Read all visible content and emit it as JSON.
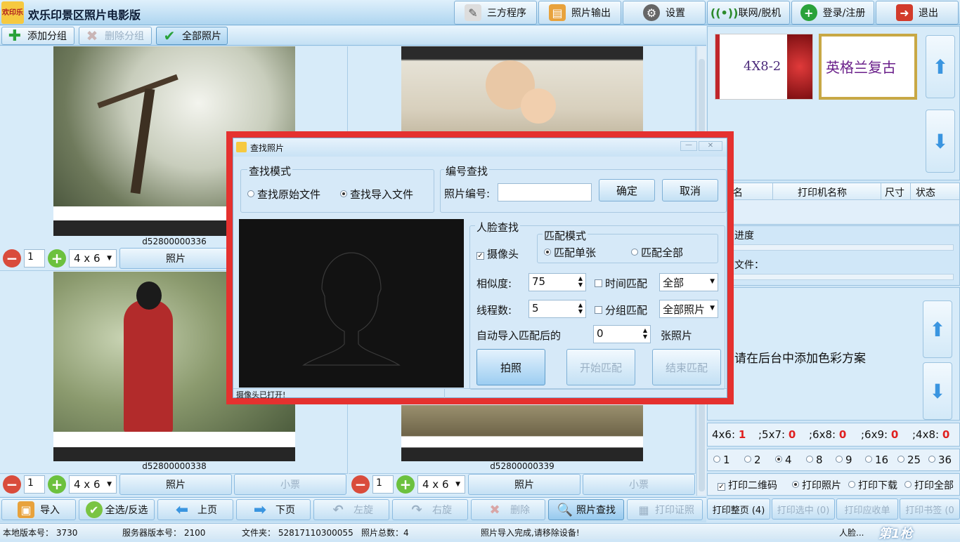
{
  "app": {
    "title": "欢乐印景区照片电影版",
    "logo_text": "欢印乐"
  },
  "toolbar": {
    "items": [
      {
        "label": "三方程序",
        "icon": "tools-icon"
      },
      {
        "label": "照片输出",
        "icon": "film-icon"
      },
      {
        "label": "设置",
        "icon": "gear-icon"
      },
      {
        "label": "联网/脱机",
        "icon": "antenna-icon"
      },
      {
        "label": "登录/注册",
        "icon": "add-user-icon"
      },
      {
        "label": "退出",
        "icon": "exit-icon"
      }
    ]
  },
  "group_bar": {
    "add": "添加分组",
    "delete": "删除分组",
    "all": "全部照片"
  },
  "photos": [
    {
      "caption": "d52800000336",
      "qty": "1",
      "size": "4 x 6",
      "btn_photo": "照片",
      "btn_ticket": ""
    },
    {
      "caption": "",
      "qty": "",
      "size": "",
      "btn_photo": "",
      "btn_ticket": ""
    },
    {
      "caption": "d52800000338",
      "qty": "1",
      "size": "4 x 6",
      "btn_photo": "照片",
      "btn_ticket": "小票"
    },
    {
      "caption": "d52800000339",
      "qty": "1",
      "size": "4 x 6",
      "btn_photo": "照片",
      "btn_ticket": "小票"
    }
  ],
  "bottom_toolbar": {
    "import": "导入",
    "select_all": "全选/反选",
    "prev": "上页",
    "next": "下页",
    "rotate_left": "左旋",
    "rotate_right": "右旋",
    "delete": "删除",
    "find_photo": "照片查找",
    "print_id": "打印证照"
  },
  "status": {
    "local_version": "本地版本号：  3730",
    "server_version": "服务器版本号：  2100",
    "folder": "文件夹：  52817110300055",
    "total": "照片总数：4",
    "message": "照片导入完成,请移除设备!",
    "right_msg": "人脸..."
  },
  "right_panel": {
    "templates": [
      "4X8-2",
      "英格兰复古"
    ],
    "printer_headers": [
      "名",
      "打印机名称",
      "尺寸",
      "状态"
    ],
    "progress_label": "进度",
    "file_label": "文件：",
    "color_scheme": "请在后台中添加色彩方案",
    "counts_text": [
      {
        "label": "4x6:",
        "value": "1"
      },
      {
        "label": ";5x7:",
        "value": "0"
      },
      {
        "label": ";6x8:",
        "value": "0"
      },
      {
        "label": ";6x9:",
        "value": "0"
      },
      {
        "label": ";4x8:",
        "value": "0"
      }
    ],
    "radios": [
      "1",
      "2",
      "4",
      "8",
      "9",
      "16",
      "25",
      "36"
    ],
    "selected_radio": "4",
    "print_options": {
      "qr": "打印二维码",
      "photo": "打印照片",
      "download": "打印下载",
      "all": "打印全部"
    },
    "print_tabs": [
      "打印整页 (4)",
      "打印选中 (0)",
      "打印应收单",
      "打印书签 (0"
    ],
    "watermark": "第1枪"
  },
  "dialog": {
    "title": "查找照片",
    "mode_group": "查找模式",
    "mode_options": [
      "查找原始文件",
      "查找导入文件"
    ],
    "mode_selected": 1,
    "number_group": "编号查找",
    "number_label": "照片编号:",
    "number_value": "",
    "confirm": "确定",
    "cancel": "取消",
    "face_group": "人脸查找",
    "camera_label": "摄像头",
    "match_mode_group": "匹配模式",
    "match_single": "匹配单张",
    "match_all": "匹配全部",
    "similarity_label": "相似度:",
    "similarity_value": "75",
    "time_match": "时间匹配",
    "time_select": "全部",
    "threads_label": "线程数:",
    "threads_value": "5",
    "group_match": "分组匹配",
    "group_select": "全部照片",
    "auto_import_label": "自动导入匹配后的",
    "auto_import_value": "0",
    "auto_import_unit": "张照片",
    "capture": "拍照",
    "start_match": "开始匹配",
    "end_match": "结束匹配",
    "status": "摄像头已打开!"
  }
}
